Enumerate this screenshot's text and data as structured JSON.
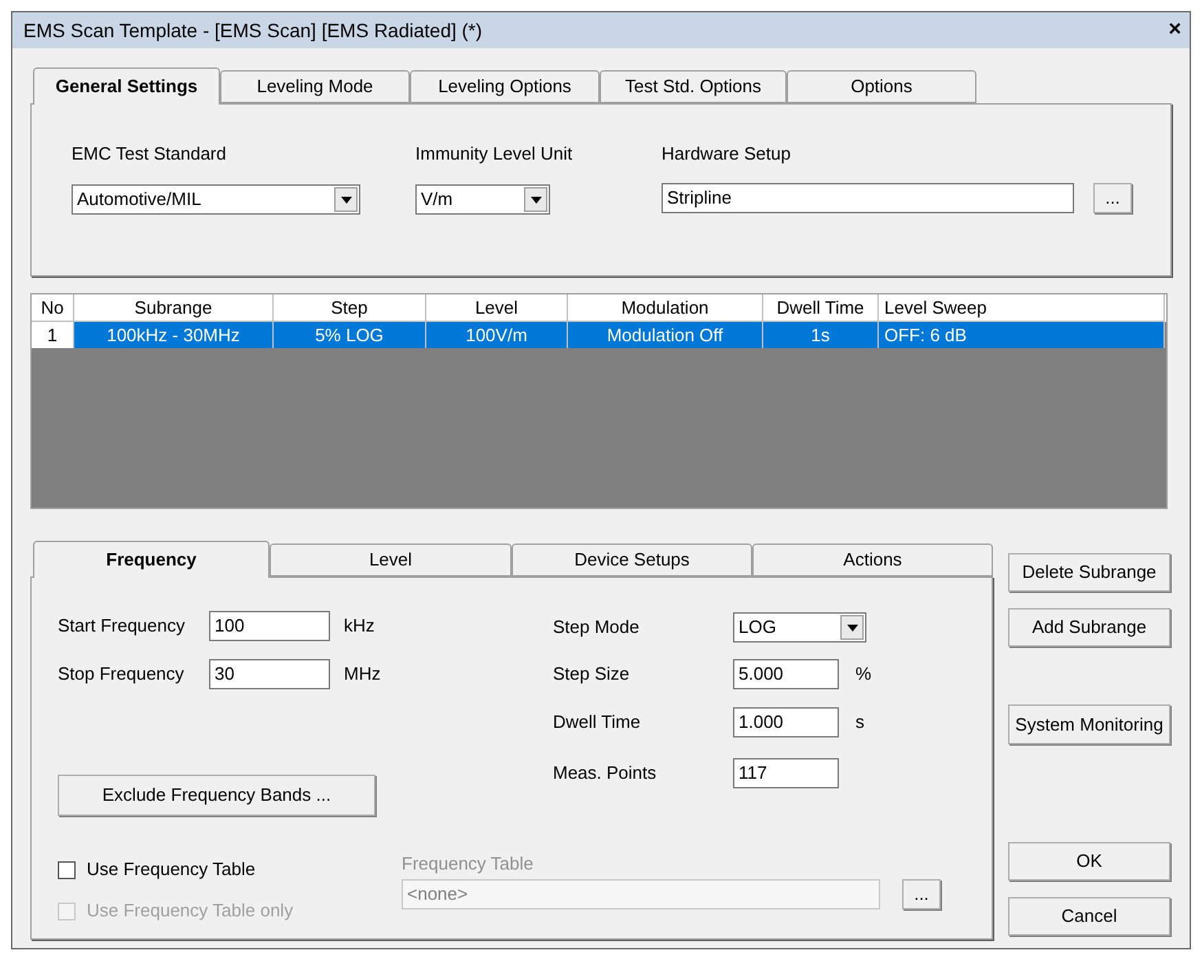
{
  "window": {
    "title": "EMS Scan Template - [EMS Scan] [EMS Radiated] (*)",
    "close": "×"
  },
  "top_tabs": [
    {
      "label": "General Settings",
      "selected": true
    },
    {
      "label": "Leveling Mode",
      "selected": false
    },
    {
      "label": "Leveling Options",
      "selected": false
    },
    {
      "label": "Test Std. Options",
      "selected": false
    },
    {
      "label": "Options",
      "selected": false
    }
  ],
  "general": {
    "emc_test_standard": {
      "label": "EMC Test Standard",
      "value": "Automotive/MIL"
    },
    "immunity_level_unit": {
      "label": "Immunity Level Unit",
      "value": "V/m"
    },
    "hardware_setup": {
      "label": "Hardware Setup",
      "value": "Stripline",
      "browse": "..."
    }
  },
  "table": {
    "columns": [
      "No",
      "Subrange",
      "Step",
      "Level",
      "Modulation",
      "Dwell Time",
      "Level Sweep"
    ],
    "rows": [
      {
        "selected": true,
        "cells": [
          "1",
          "100kHz - 30MHz",
          "5% LOG",
          "100V/m",
          "Modulation Off",
          "1s",
          "OFF: 6 dB"
        ]
      }
    ]
  },
  "bottom_tabs": [
    {
      "label": "Frequency",
      "selected": true
    },
    {
      "label": "Level",
      "selected": false
    },
    {
      "label": "Device Setups",
      "selected": false
    },
    {
      "label": "Actions",
      "selected": false
    }
  ],
  "frequency": {
    "start_frequency": {
      "label": "Start Frequency",
      "value": "100",
      "unit": "kHz"
    },
    "stop_frequency": {
      "label": "Stop Frequency",
      "value": "30",
      "unit": "MHz"
    },
    "exclude_button": "Exclude Frequency Bands ...",
    "step_mode": {
      "label": "Step Mode",
      "value": "LOG"
    },
    "step_size": {
      "label": "Step Size",
      "value": "5.000",
      "unit": "%"
    },
    "dwell_time": {
      "label": "Dwell Time",
      "value": "1.000",
      "unit": "s"
    },
    "meas_points": {
      "label": "Meas. Points",
      "value": "117"
    },
    "use_frequency_table": {
      "label": "Use Frequency Table",
      "checked": false,
      "disabled": false
    },
    "use_frequency_table_only": {
      "label": "Use Frequency Table only",
      "checked": false,
      "disabled": true
    },
    "frequency_table": {
      "label": "Frequency Table",
      "value": "<none>",
      "disabled": true,
      "browse": "..."
    }
  },
  "side_buttons": [
    "Delete Subrange",
    "Add Subrange"
  ],
  "monitoring_button": "System Monitoring",
  "dialog_buttons": [
    "OK",
    "Cancel"
  ]
}
